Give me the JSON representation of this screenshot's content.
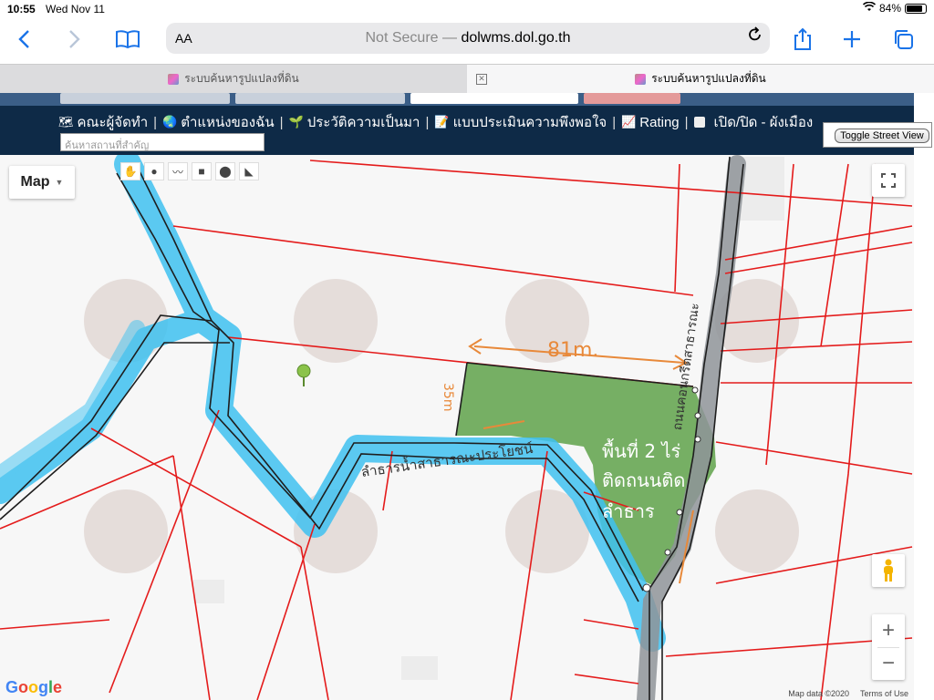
{
  "status_bar": {
    "time": "10:55",
    "date": "Wed Nov 11",
    "battery": "84%",
    "battery_level": 0.84
  },
  "browser": {
    "aa_label": "AA",
    "url_prefix": "Not Secure — ",
    "url_host": "dolwms.dol.go.th",
    "tabs": [
      {
        "title": "ระบบค้นหารูปแปลงที่ดิน",
        "active": false
      },
      {
        "title": "ระบบค้นหารูปแปลงที่ดิน",
        "active": true
      }
    ]
  },
  "site": {
    "nav": [
      {
        "label": "คณะผู้จัดทำ",
        "icon": "map-icon"
      },
      {
        "label": "ตำแหน่งของฉัน",
        "icon": "globe-icon"
      },
      {
        "label": "ประวัติความเป็นมา",
        "icon": "sprout-icon"
      },
      {
        "label": "แบบประเมินความพึงพอใจ",
        "icon": "notepad-icon"
      },
      {
        "label": "Rating",
        "icon": "chart-icon"
      },
      {
        "label": "เปิด/ปิด - ผังเมือง",
        "icon": "checkbox-icon"
      }
    ],
    "search_placeholder": "ค้นหาสถานที่สำคัญ",
    "streetview_button": "Toggle Street View"
  },
  "map": {
    "type_label": "Map",
    "annotations": {
      "top_length": "81m.",
      "left_length": "35m",
      "area_text_line1": "พื้นที่ 2 ไร่",
      "area_text_line2": "ติดถนนติด",
      "area_text_line3": "ลำธาร",
      "canal_label": "ลำธารน้ำสาธารณะประโยชน์",
      "road_label": "ถนนคอนกรีตสาธารณะ"
    },
    "google_logo": "Google",
    "attribution": "Map data ©2020",
    "terms": "Terms of Use",
    "colors": {
      "parcel_line": "#e41b1b",
      "water": "#3fc1f0",
      "parcel_fill": "#5fa24a",
      "road": "#9aa0a6",
      "annotation": "#e8893a"
    }
  }
}
